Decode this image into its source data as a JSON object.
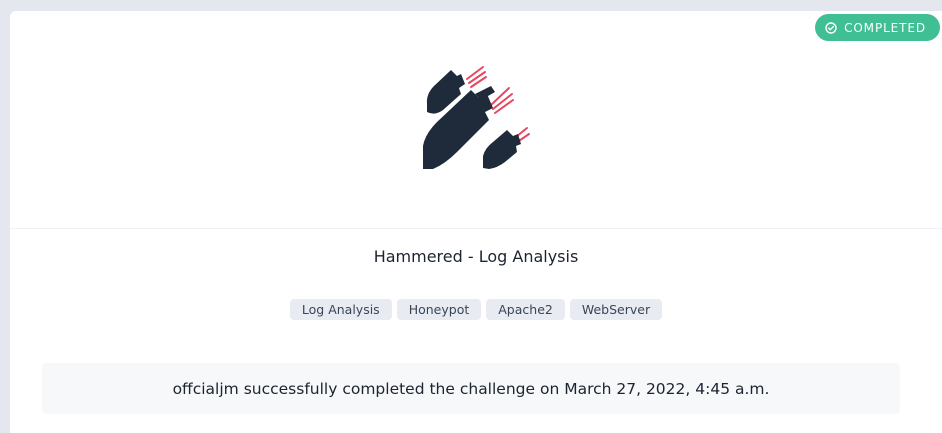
{
  "status_badge": {
    "label": "COMPLETED",
    "icon": "check-circle-icon",
    "color": "#3fbf93"
  },
  "hero": {
    "icon": "bombs-icon",
    "accent_color": "#e8475f",
    "body_color": "#1f2b3a"
  },
  "challenge": {
    "title": "Hammered - Log Analysis",
    "tags": [
      "Log Analysis",
      "Honeypot",
      "Apache2",
      "WebServer"
    ]
  },
  "completion": {
    "message": "offcialjm successfully completed the challenge on March 27, 2022, 4:45 a.m."
  }
}
